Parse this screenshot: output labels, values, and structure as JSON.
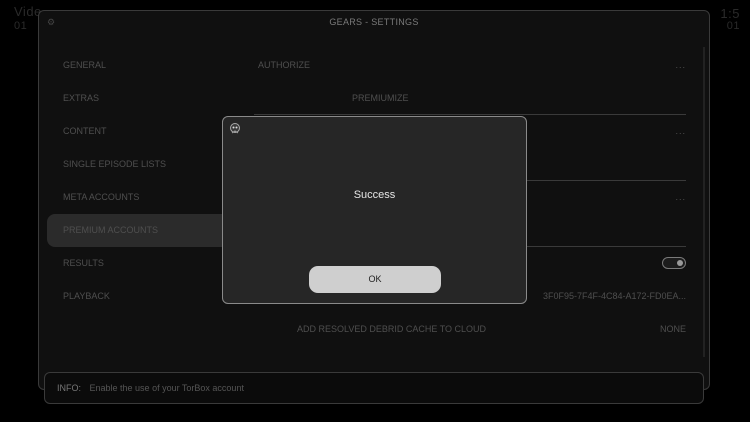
{
  "background": {
    "top_left_text": "Vide",
    "top_left_sub": "01",
    "top_right_text": "1:5",
    "top_right_sub": "01"
  },
  "window": {
    "title": "GEARS - SETTINGS"
  },
  "categories": [
    {
      "label": "GENERAL",
      "selected": false
    },
    {
      "label": "EXTRAS",
      "selected": false
    },
    {
      "label": "CONTENT",
      "selected": false
    },
    {
      "label": "SINGLE EPISODE LISTS",
      "selected": false
    },
    {
      "label": "META ACCOUNTS",
      "selected": false
    },
    {
      "label": "PREMIUM ACCOUNTS",
      "selected": true
    },
    {
      "label": "RESULTS",
      "selected": false
    },
    {
      "label": "PLAYBACK",
      "selected": false
    }
  ],
  "settings": {
    "row0": {
      "label": "AUTHORIZE",
      "value": "..."
    },
    "row1": {
      "label": "PREMIUMIZE"
    },
    "row2": {
      "value": "..."
    },
    "row4": {
      "value": "..."
    },
    "row7": {
      "value": "3F0F95-7F4F-4C84-A172-FD0EA..."
    },
    "row8": {
      "label": "ADD RESOLVED DEBRID CACHE TO CLOUD",
      "value": "NONE"
    }
  },
  "info": {
    "label": "INFO:",
    "text": "Enable the use of your TorBox account"
  },
  "dialog": {
    "message": "Success",
    "ok_label": "OK"
  },
  "colors": {
    "dialog_bg": "#262626",
    "ok_button_bg": "#cfcfcf",
    "selected_category_bg": "#2b2b2b"
  }
}
